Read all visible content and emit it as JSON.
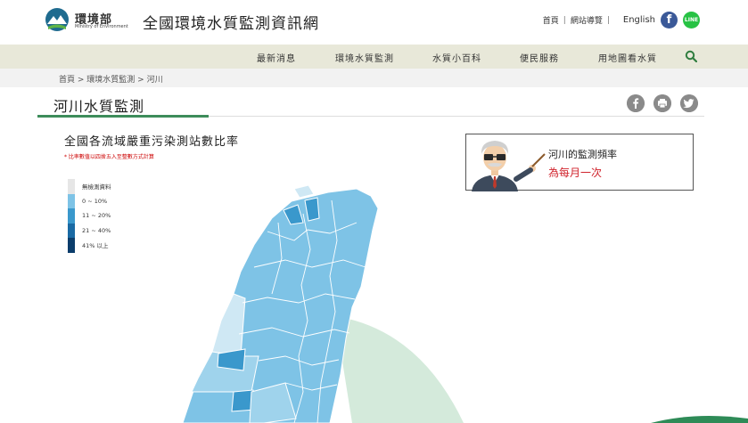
{
  "header": {
    "agency_name": "環境部",
    "agency_name_en": "Ministry of Environment",
    "site_title": "全國環境水質監測資訊網",
    "top_links": [
      "首頁",
      "網站導覽",
      "English"
    ],
    "social": {
      "facebook": "f",
      "line": "LINE"
    }
  },
  "nav": {
    "items": [
      "最新消息",
      "環境水質監測",
      "水質小百科",
      "便民服務",
      "用地圖看水質"
    ],
    "search_icon": "search-icon"
  },
  "breadcrumb": {
    "items": [
      "首頁",
      "環境水質監測",
      "河川"
    ],
    "separator": " > "
  },
  "page": {
    "title": "河川水質監測",
    "share_icons": [
      "facebook-icon",
      "print-icon",
      "twitter-icon"
    ]
  },
  "map_section": {
    "title": "全國各流域嚴重污染測站數比率",
    "note": "* 比率數值以四捨五入至整數方式計算",
    "legend": [
      {
        "label": "無檢測資料",
        "color": "#e6e6e6"
      },
      {
        "label": "0 ~ 10%",
        "color": "#7ec3e6"
      },
      {
        "label": "11 ~ 20%",
        "color": "#3a98cc"
      },
      {
        "label": "21 ~ 40%",
        "color": "#1a6aa4"
      },
      {
        "label": "41% 以上",
        "color": "#0b3d6b"
      }
    ]
  },
  "teacher": {
    "question": "河川的監測頻率",
    "answer": "為每月一次"
  },
  "colors": {
    "nav_bg": "#e8e8d9",
    "accent_green": "#3d8c5a",
    "answer_red": "#d0222b"
  }
}
